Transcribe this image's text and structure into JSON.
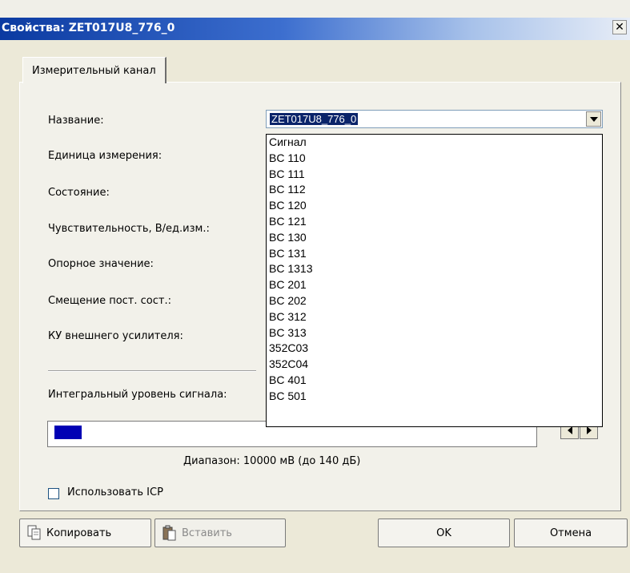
{
  "window": {
    "title": "Свойства: ZET017U8_776_0"
  },
  "icons": {
    "close": "close-icon",
    "copy": "copy-icon",
    "paste": "paste-icon"
  },
  "tabs": [
    {
      "label": "Измерительный канал"
    }
  ],
  "fields": {
    "name_label": "Название:",
    "unit_label": "Единица измерения:",
    "state_label": "Состояние:",
    "sensitivity_label": "Чувствительность, В/ед.изм.:",
    "reference_label": "Опорное значение:",
    "offset_label": "Смещение пост. сост.:",
    "gain_label": "КУ внешнего усилителя:",
    "integral_label": "Интегральный уровень сигнала:"
  },
  "name_combo": {
    "value": "ZET017U8_776_0",
    "options": [
      "Сигнал",
      "BC 110",
      "BC 111",
      "BC 112",
      "BC 120",
      "BC 121",
      "BC 130",
      "BC 131",
      "BC 1313",
      "BC 201",
      "BC 202",
      "BC 312",
      "BC 313",
      "352C03",
      "352C04",
      "BC 401",
      "BC 501"
    ]
  },
  "level": {
    "fill_fraction": 0.06,
    "color": "#0000b4"
  },
  "range_text": "Диапазон: 10000 мВ (до 140 дБ)",
  "icp": {
    "label": "Использовать ICP",
    "checked": false
  },
  "buttons": {
    "copy": "Копировать",
    "paste": "Вставить",
    "ok": "OK",
    "cancel": "Отмена"
  },
  "colors": {
    "title_bar": "#0b3aa1",
    "selection": "#0a246a",
    "level_fill": "#0000b4"
  }
}
